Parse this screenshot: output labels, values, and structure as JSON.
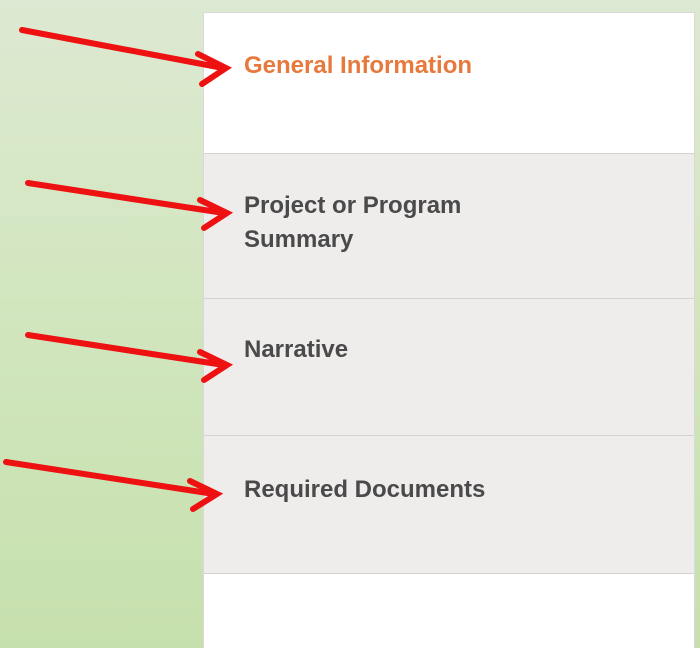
{
  "tabs": [
    {
      "label": "General Information",
      "active": true
    },
    {
      "label": "Project or Program Summary",
      "active": false
    },
    {
      "label": "Narrative",
      "active": false
    },
    {
      "label": "Required Documents",
      "active": false
    }
  ],
  "colors": {
    "active_text": "#e8793c",
    "inactive_text": "#4a4a4a",
    "inactive_bg": "#efecec",
    "arrow": "#ee1111",
    "background_green": "#c6e0ad"
  },
  "annotations": {
    "arrow_icon": "red-arrow-icon"
  }
}
